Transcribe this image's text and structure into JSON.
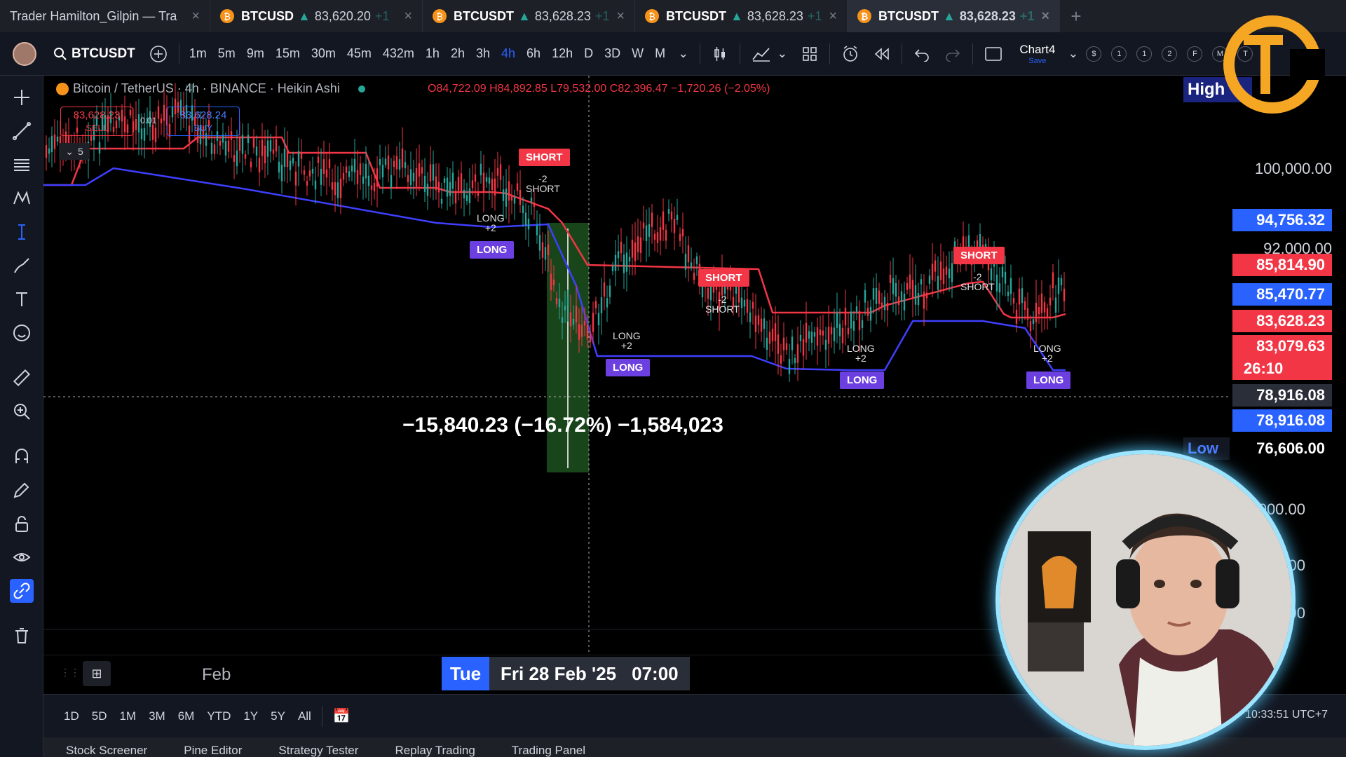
{
  "browser_tabs": [
    {
      "title": "Trader Hamilton_Gilpin — Tra",
      "active": false
    },
    {
      "title": "BTCUSD",
      "price": "83,620.20",
      "change": "+1",
      "active": false
    },
    {
      "title": "BTCUSDT",
      "price": "83,628.23",
      "change": "+1",
      "active": false
    },
    {
      "title": "BTCUSDT",
      "price": "83,628.23",
      "change": "+1",
      "active": false
    },
    {
      "title": "BTCUSDT",
      "price": "83,628.23",
      "change": "+1",
      "active": true
    }
  ],
  "toolbar": {
    "symbol": "BTCUSDT",
    "intervals": [
      "1m",
      "5m",
      "9m",
      "15m",
      "30m",
      "45m",
      "432m",
      "1h",
      "2h",
      "3h",
      "4h",
      "6h",
      "12h",
      "D",
      "3D",
      "W",
      "M"
    ],
    "active_interval": "4h",
    "layout_name": "Chart4",
    "layout_save": "Save",
    "right_buttons": [
      "$",
      "1",
      "1",
      "2",
      "F",
      "M",
      "T"
    ]
  },
  "legend": {
    "title": "Bitcoin / TetherUS · 4h · BINANCE · Heikin Ashi",
    "ohlc": "O84,722.09 H84,892.85 L79,532.00 C82,396.47 −1,720.26 (−2.05%)"
  },
  "trade_panel": {
    "sell_price": "83,628.23",
    "sell_label": "SELL",
    "spread": "0.01",
    "buy_price": "83,628.24",
    "buy_label": "BUY",
    "quantity": "5"
  },
  "measure": {
    "label": "−15,840.23 (−16.72%) −1,584,023"
  },
  "signals": [
    {
      "type": "SHORT",
      "sub": "SHORT",
      "sub2": "-2"
    },
    {
      "type": "LONG",
      "sub": "LONG",
      "sub2": "+2"
    },
    {
      "type": "SHORT",
      "sub": "SHORT",
      "sub2": "-2"
    },
    {
      "type": "LONG",
      "sub": "LONG",
      "sub2": "+2"
    },
    {
      "type": "SHORT",
      "sub": "SHORT",
      "sub2": "-2"
    },
    {
      "type": "LONG",
      "sub": "LONG",
      "sub2": "+2"
    },
    {
      "type": "LONG",
      "sub": "LONG",
      "sub2": "+2"
    },
    {
      "type": "SHORT",
      "sub": "SHORT",
      "sub2": ""
    }
  ],
  "price_axis": {
    "high_label": "High",
    "low_label": "Low",
    "grid": [
      "100,000.00",
      "92,000.00",
      "000.00",
      ".00",
      ".00"
    ],
    "labels": [
      {
        "value": "94,756.32",
        "color": "#2962ff"
      },
      {
        "value": "85,814.90",
        "color": "#f23645"
      },
      {
        "value": "85,470.77",
        "color": "#2962ff"
      },
      {
        "value": "83,628.23",
        "color": "#f23645"
      },
      {
        "value": "83,079.63",
        "color": "#f23645"
      },
      {
        "value": "26:10",
        "color": "#f23645"
      },
      {
        "value": "78,916.08",
        "color": "#2a2e39"
      },
      {
        "value": "78,916.08",
        "color": "#2962ff"
      },
      {
        "value": "76,606.00",
        "color": "#000000"
      }
    ]
  },
  "time_axis": {
    "month_label": "Feb",
    "cursor_day": "Tue",
    "cursor_date": "Fri 28 Feb '25",
    "cursor_time": "07:00"
  },
  "range_bar": {
    "ranges": [
      "1D",
      "5D",
      "1M",
      "3M",
      "6M",
      "YTD",
      "1Y",
      "5Y",
      "All"
    ],
    "clock": "10:33:51 UTC+7"
  },
  "bottom_panels": [
    "Stock Screener",
    "Pine Editor",
    "Strategy Tester",
    "Replay Trading",
    "Trading Panel"
  ],
  "colors": {
    "accent": "#2962ff",
    "short": "#f23645",
    "long": "#7b3ff2",
    "up": "#26a69a"
  }
}
